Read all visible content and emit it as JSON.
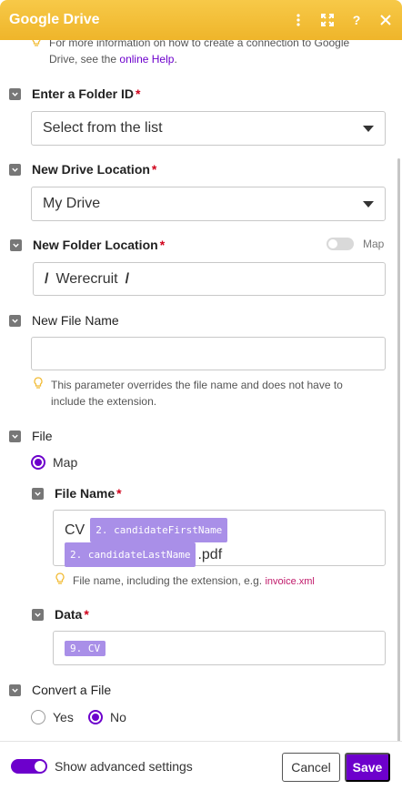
{
  "header": {
    "title": "Google Drive"
  },
  "top_hint": {
    "text": "For more information on how to create a connection to Google Drive, see the",
    "link": "online Help",
    "suffix": "."
  },
  "folder_id": {
    "label": "Enter a Folder ID",
    "required": "*",
    "value": "Select from the list"
  },
  "drive_location": {
    "label": "New Drive Location",
    "required": "*",
    "value": "My Drive"
  },
  "folder_location": {
    "label": "New Folder Location",
    "required": "*",
    "map_label": "Map",
    "sep1": "/",
    "value": "Werecruit",
    "sep2": "/"
  },
  "file_name_top": {
    "label": "New File Name",
    "value": "",
    "hint": "This parameter overrides the file name and does not have to include the extension."
  },
  "file": {
    "label": "File",
    "map_label": "Map"
  },
  "file_name": {
    "label": "File Name",
    "required": "*",
    "prefix": "CV",
    "pill1": "2. candidateFirstName",
    "pill2": "2. candidateLastName",
    "suffix": ".pdf",
    "hint": "File name, including the extension, e.g.",
    "hint_code": "invoice.xml"
  },
  "data": {
    "label": "Data",
    "required": "*",
    "pill": "9. CV"
  },
  "convert": {
    "label": "Convert a File",
    "yes": "Yes",
    "no": "No",
    "selected": "No"
  },
  "footer": {
    "advanced": "Show advanced settings",
    "cancel": "Cancel",
    "save": "Save"
  },
  "colors": {
    "header": "#f2bc37",
    "accent": "#6d00cc",
    "pill": "#a98fe8",
    "required": "#d0021b"
  }
}
